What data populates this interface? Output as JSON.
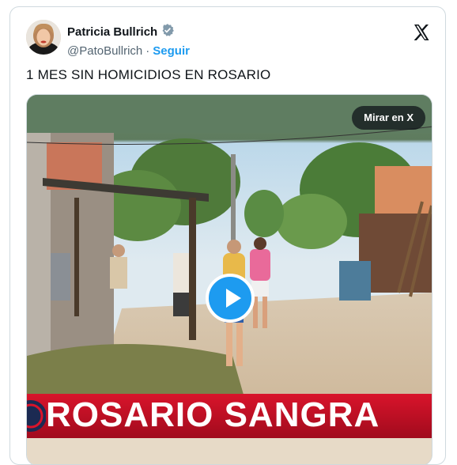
{
  "author": {
    "name": "Patricia Bullrich",
    "handle": "@PatoBullrich",
    "separator": "·",
    "follow_label": "Seguir",
    "verified_icon": "verified-badge-icon",
    "avatar_icon": "avatar"
  },
  "brand": {
    "logo_icon": "x-logo-icon"
  },
  "tweet": {
    "text": "1 MES SIN HOMICIDIOS EN ROSARIO"
  },
  "media": {
    "watch_label": "Mirar en X",
    "play_icon": "play-icon",
    "banner_text": "ROSARIO SANGRA"
  },
  "colors": {
    "accent": "#1d9bf0",
    "banner_red": "#d9142b",
    "text": "#0f1419",
    "muted": "#536471"
  }
}
